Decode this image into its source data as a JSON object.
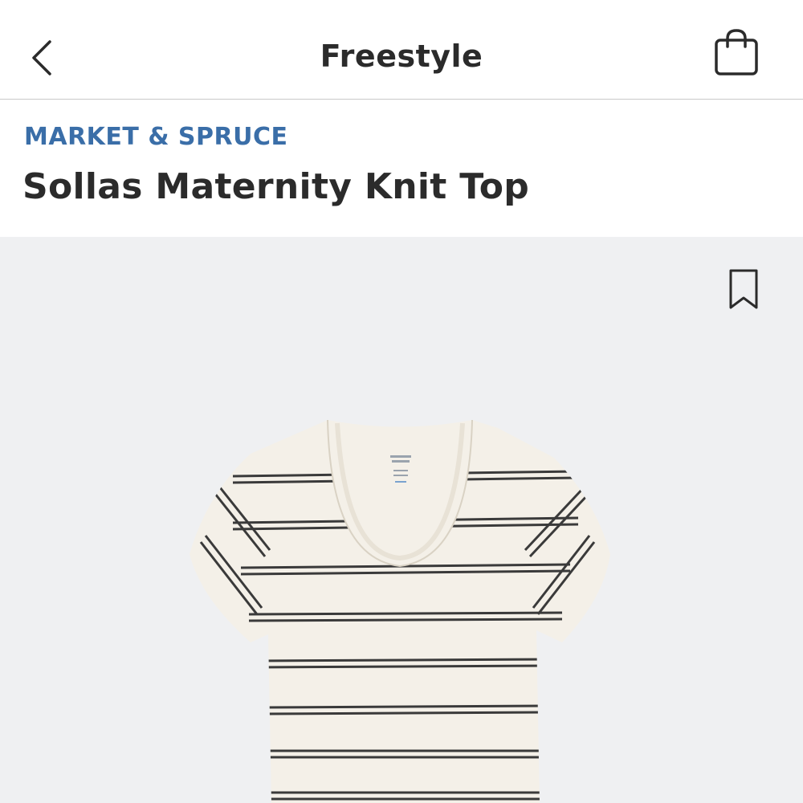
{
  "header": {
    "title": "Freestyle",
    "back_icon": "chevron-left-icon",
    "bag_icon": "shopping-bag-icon"
  },
  "product": {
    "brand": "MARKET & SPRUCE",
    "name": "Sollas Maternity Knit Top",
    "save_icon": "bookmark-icon",
    "image_description_icon": "striped-tshirt-image"
  },
  "colors": {
    "brand_accent": "#3a6ea8",
    "text_primary": "#2b2b2b",
    "image_background": "#eff0f2",
    "shirt_base": "#f4f0e8",
    "stripe": "#3a3a3a"
  }
}
